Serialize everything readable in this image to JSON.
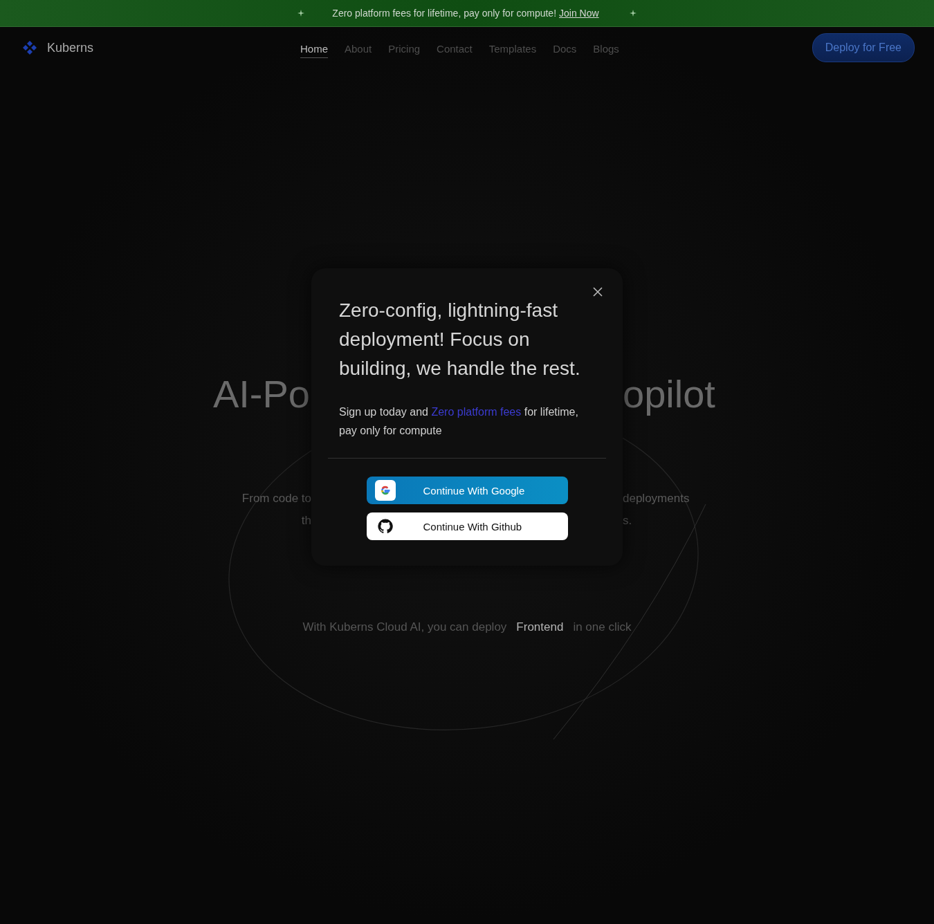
{
  "banner": {
    "text": "Zero platform fees for lifetime, pay only for compute!",
    "link": "Join Now"
  },
  "nav": {
    "logo": "Kuberns",
    "links": [
      {
        "label": "Home",
        "selected": true
      },
      {
        "label": "About",
        "selected": false
      },
      {
        "label": "Pricing",
        "selected": false
      },
      {
        "label": "Contact",
        "selected": false
      },
      {
        "label": "Templates",
        "selected": false
      },
      {
        "label": "Docs",
        "selected": false
      },
      {
        "label": "Blogs",
        "selected": false
      }
    ],
    "cta": "Deploy for Free"
  },
  "hero": {
    "title_left": "AI-Po",
    "title_right": "opilot",
    "subtitle_lines": [
      {
        "left": "From code to",
        "right": "deployments"
      },
      {
        "left": "th",
        "right": "s."
      }
    ],
    "tagline": {
      "before": "With Kuberns Cloud AI, you can deploy",
      "highlight": "Frontend",
      "after": "in one click"
    }
  },
  "modal": {
    "title": "Zero-config, lightning-fast deployment! Focus on building, we handle the rest.",
    "body_before": "Sign up today and",
    "body_link": "Zero platform fees",
    "body_after": "for lifetime, pay only for compute",
    "buttons": [
      {
        "label": "Continue With Google",
        "kind": "google"
      },
      {
        "label": "Continue With Github",
        "kind": "github"
      }
    ]
  }
}
